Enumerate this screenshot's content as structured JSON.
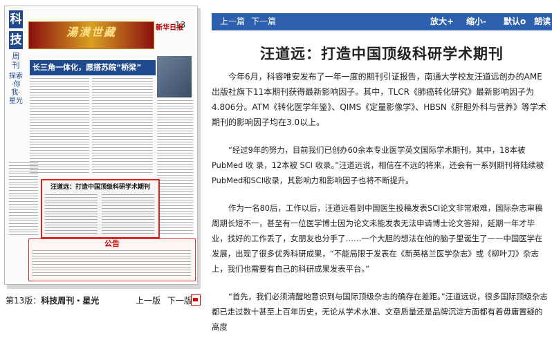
{
  "thumbnail": {
    "masthead_top": "科",
    "masthead_bottom": "技",
    "masthead_sub": "周刊",
    "masthead_vertical": "探索·你我·星光",
    "ad_text": "湯潢世藏",
    "paper_logo": "新华日报",
    "page_number": "13",
    "headline": "长三角一体化，愿搭苏皖“桥梁”",
    "highlight_article_title": "汪道远：打造中国顶级科研学术期刊",
    "notice_title": "公告"
  },
  "footer": {
    "edition_prefix": "第13版：",
    "edition_name": "科技周刊・星光",
    "prev_page": "上一版",
    "next_page": "下一版"
  },
  "toolbar": {
    "prev_article": "上一篇",
    "next_article": "下一篇",
    "zoom_in": "放大+",
    "zoom_out": "缩小-",
    "default": "默认o",
    "read": "朗读"
  },
  "article": {
    "title": "汪道远：打造中国顶级科研学术期刊",
    "paragraphs": [
      "今年6月，科睿唯安发布了一年一度的期刊引证报告，南通大学校友汪道远创办的AME出版社旗下11本期刊获得最新影响因子。其中，TLCR《肺癌转化研究》最新影响因子为4.806分。ATM《转化医学年鉴》、QIMS《定量影像学》、HBSN《肝胆外科与营养》等学术期刊的影响因子均在3.0以上。",
      "“经过9年的努力，目前我们已创办60余本专业医学英文国际学术期刊，其中，18本被 PubMed 收 录，12本被 SCI 收录。”汪道远说，相信在不远的将来，还会有一系列期刊将陆续被 PubMed和SCI收录，其影响力和影响因子也将不断提升。",
      "作为一名80后，工作以后，汪道远看到中国医生投稿发表SCI论文非常艰难，国际杂志审稿周期长短不一，甚至有一位医学博士因为论文未能发表无法申请博士论文答辩，延期一年才毕业，找好的工作丢了，女朋友也分手了……一个大胆的想法在他的脑子里诞生了——中国医学在发展，出现了很多优秀科研成果，“不能局限于发表在《新英格兰医学杂志》或《柳叶刀》杂志上，我们也需要有自己的科研成果发表平台。”",
      "“首先，我们必须清醒地意识到与国际顶级杂志的确存在差距。”汪道远说，很多国际顶级杂志都已走过数十甚至上百年历史，无论从学术水准、文章质量还是品牌沉淀方面都有着毋庸置疑的高度"
    ]
  }
}
